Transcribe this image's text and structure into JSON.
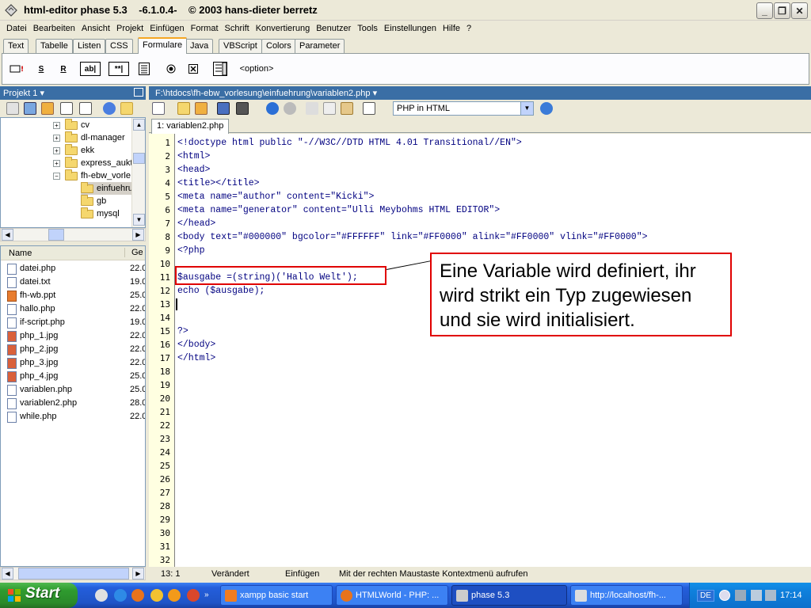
{
  "window": {
    "title": "html-editor phase 5.3    -6.1.0.4-    © 2003 hans-dieter berretz"
  },
  "menu": [
    "Datei",
    "Bearbeiten",
    "Ansicht",
    "Projekt",
    "Einfügen",
    "Format",
    "Schrift",
    "Konvertierung",
    "Benutzer",
    "Tools",
    "Einstellungen",
    "Hilfe",
    "?"
  ],
  "tabs": [
    "Text",
    "Tabelle",
    "Listen",
    "CSS",
    "Formulare",
    "Java",
    "VBScript",
    "Colors",
    "Parameter"
  ],
  "active_tab": "Formulare",
  "form_toolbar": {
    "option_label": "<option>"
  },
  "project_panel": {
    "title": "Projekt 1"
  },
  "tree": [
    {
      "label": "cv",
      "expander": "+"
    },
    {
      "label": "dl-manager",
      "expander": "+"
    },
    {
      "label": "ekk",
      "expander": "+"
    },
    {
      "label": "express_aukt",
      "expander": "+"
    },
    {
      "label": "fh-ebw_vorle:",
      "expander": "−"
    },
    {
      "label": "einfuehru",
      "expander": ""
    },
    {
      "label": "gb",
      "expander": ""
    },
    {
      "label": "mysql",
      "expander": ""
    }
  ],
  "file_list": {
    "columns": [
      "Name",
      "Ge"
    ],
    "rows": [
      {
        "name": "datei.php",
        "size": "22.0"
      },
      {
        "name": "datei.txt",
        "size": "19.0"
      },
      {
        "name": "fh-wb.ppt",
        "size": "25.0"
      },
      {
        "name": "hallo.php",
        "size": "22.0"
      },
      {
        "name": "if-script.php",
        "size": "19.0"
      },
      {
        "name": "php_1.jpg",
        "size": "22.0"
      },
      {
        "name": "php_2.jpg",
        "size": "22.0"
      },
      {
        "name": "php_3.jpg",
        "size": "22.0"
      },
      {
        "name": "php_4.jpg",
        "size": "25.0"
      },
      {
        "name": "variablen.php",
        "size": "25.0"
      },
      {
        "name": "variablen2.php",
        "size": "28.0"
      },
      {
        "name": "while.php",
        "size": "22.0"
      }
    ]
  },
  "editor": {
    "path": "F:\\htdocs\\fh-ebw_vorlesung\\einfuehrung\\variablen2.php",
    "mode": "PHP in HTML",
    "file_tab": "1: variablen2.php",
    "lines": [
      "<!doctype html public \"-//W3C//DTD HTML 4.01 Transitional//EN\">",
      "<html>",
      "<head>",
      "<title></title>",
      "<meta name=\"author\" content=\"Kicki\">",
      "<meta name=\"generator\" content=\"Ulli Meybohms HTML EDITOR\">",
      "</head>",
      "<body text=\"#000000\" bgcolor=\"#FFFFFF\" link=\"#FF0000\" alink=\"#FF0000\" vlink=\"#FF0000\">",
      "<?php",
      "",
      "$ausgabe =(string)('Hallo Welt');",
      "echo ($ausgabe);",
      "",
      "",
      "?>",
      "</body>",
      "</html>"
    ],
    "line_count": 32
  },
  "callout": "Eine Variable wird definiert, ihr wird strikt ein Typ zugewiesen und sie wird initialisiert.",
  "status": {
    "position": "13: 1",
    "modified": "Verändert",
    "insert": "Einfügen",
    "hint": "Mit der rechten Maustaste Kontextmenü aufrufen"
  },
  "taskbar": {
    "start": "Start",
    "tasks": [
      "xampp basic start",
      "HTMLWorld - PHP: ...",
      "phase 5.3",
      "http://localhost/fh-..."
    ],
    "language": "DE",
    "clock": "17:14"
  },
  "colors": {
    "accent_red": "#e00000",
    "panel_blue": "#3a6ea5",
    "taskbar_blue": "#245edb"
  }
}
